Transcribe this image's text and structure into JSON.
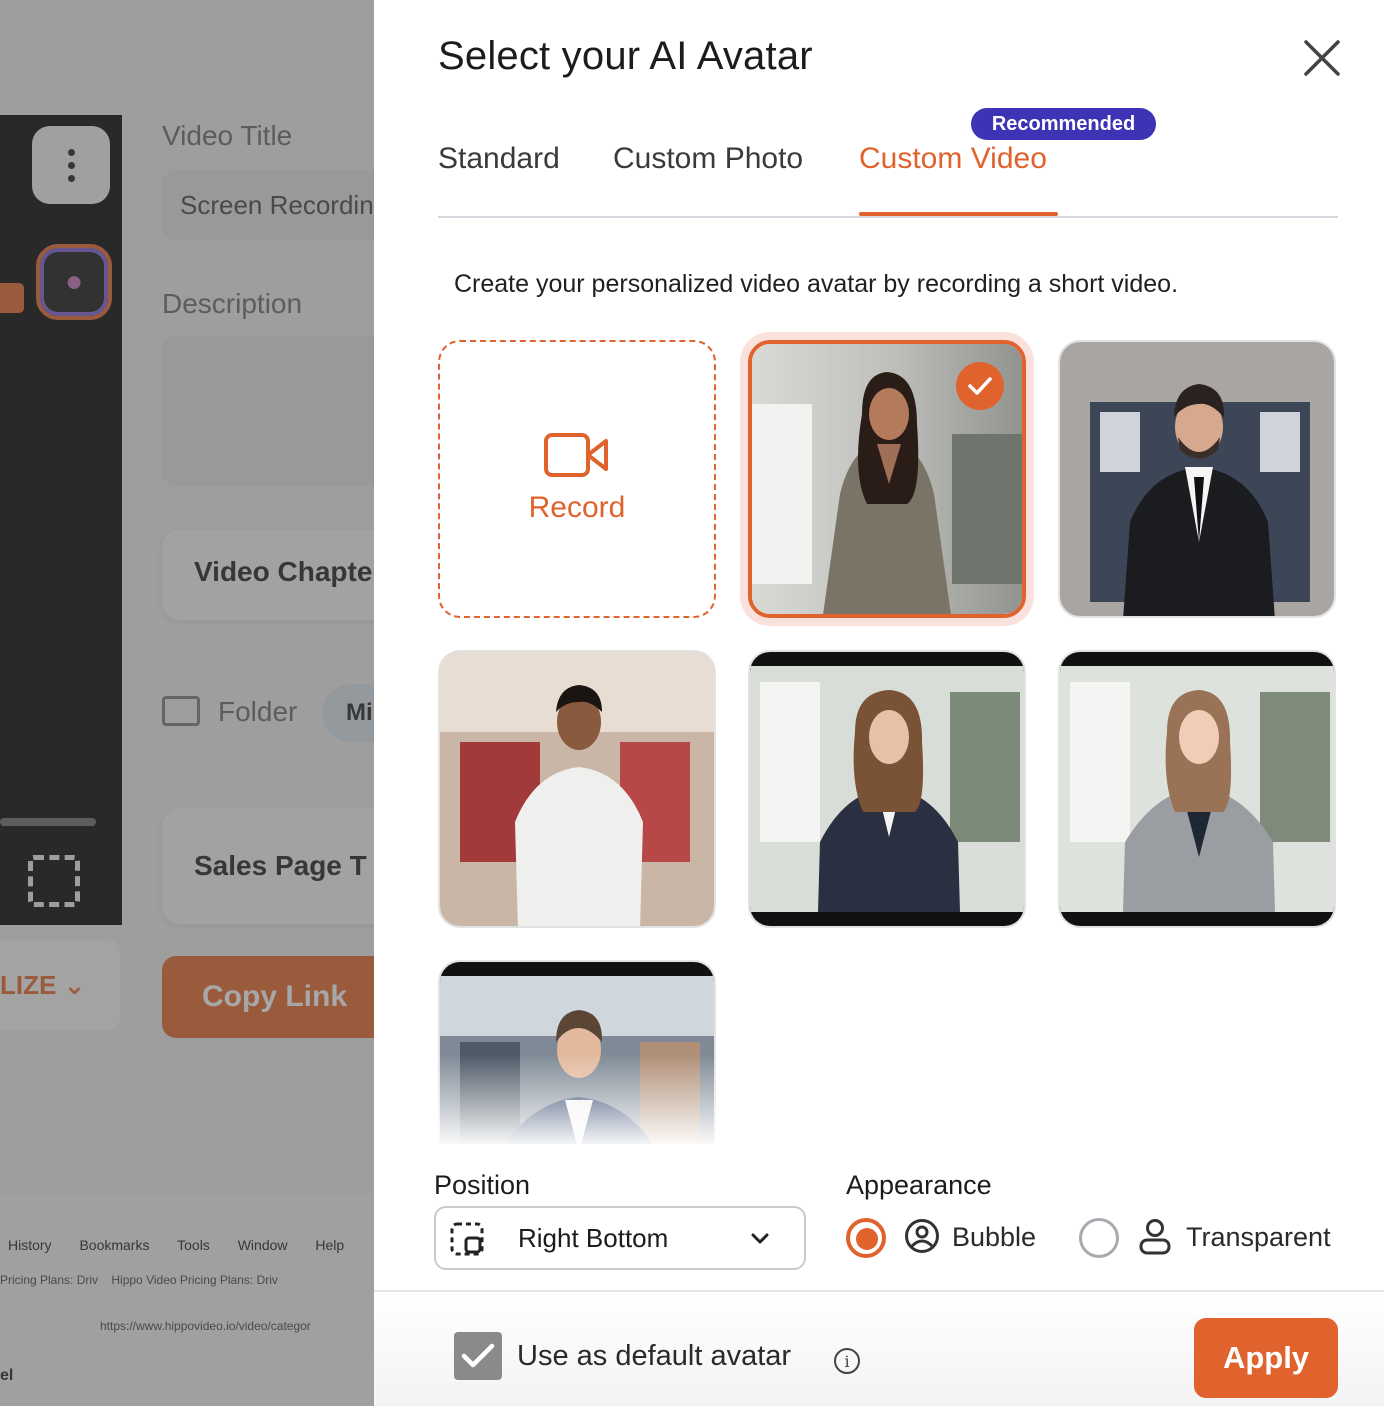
{
  "background": {
    "labels": {
      "video_title": "Video Title",
      "video_title_value": "Screen Recordin",
      "description": "Description",
      "video_chapters": "Video Chapte",
      "folder": "Folder",
      "folder_pill": "Mi",
      "sales_page": "Sales Page T",
      "copy_link": "Copy Link",
      "personalize": "LIZE"
    },
    "browser_menu": [
      "History",
      "Bookmarks",
      "Tools",
      "Window",
      "Help"
    ],
    "browser_tabs": [
      "Pricing Plans: Driv",
      "Hippo Video Pricing Plans: Driv"
    ],
    "address": "https://www.hippovideo.io/video/categor",
    "corner_text": "el"
  },
  "modal": {
    "title": "Select your AI Avatar",
    "tabs": [
      {
        "label": "Standard",
        "active": false
      },
      {
        "label": "Custom Photo",
        "active": false
      },
      {
        "label": "Custom Video",
        "active": true
      }
    ],
    "badge": "Recommended",
    "description": "Create your personalized video avatar by recording a short video.",
    "record_label": "Record",
    "avatars": [
      {
        "name": "woman-gray-blazer",
        "selected": true
      },
      {
        "name": "man-black-suit",
        "selected": false
      },
      {
        "name": "man-white-shirt",
        "selected": false
      },
      {
        "name": "woman-pinstripe-suit",
        "selected": false
      },
      {
        "name": "woman-gray-blazer-2",
        "selected": false
      },
      {
        "name": "man-navy-blazer",
        "selected": false
      }
    ],
    "position": {
      "label": "Position",
      "value": "Right Bottom"
    },
    "appearance": {
      "label": "Appearance",
      "options": [
        {
          "label": "Bubble",
          "selected": true
        },
        {
          "label": "Transparent",
          "selected": false
        }
      ]
    },
    "default_avatar": {
      "label": "Use as default avatar",
      "checked": true
    },
    "apply_label": "Apply",
    "accent_color": "#e0622d",
    "badge_color": "#3c34b5"
  }
}
